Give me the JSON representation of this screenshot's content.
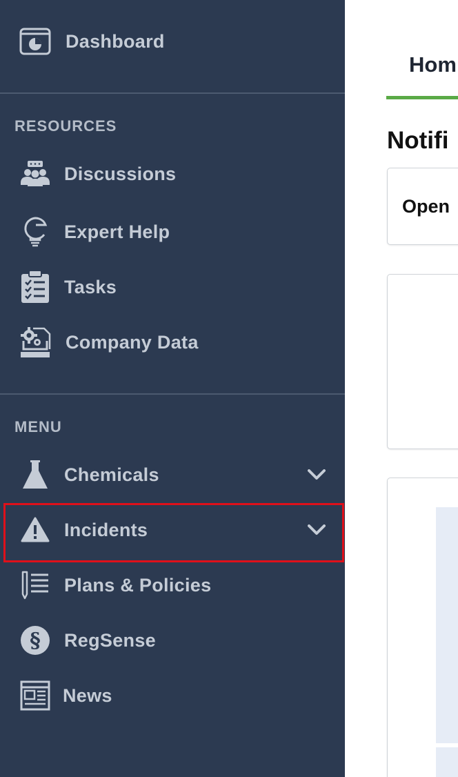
{
  "sidebar": {
    "dashboard": {
      "label": "Dashboard",
      "icon": "dashboard-icon"
    },
    "resources": {
      "header": "RESOURCES",
      "items": [
        {
          "label": "Discussions",
          "icon": "discussions-icon"
        },
        {
          "label": "Expert Help",
          "icon": "expert-help-icon"
        },
        {
          "label": "Tasks",
          "icon": "tasks-icon"
        },
        {
          "label": "Company Data",
          "icon": "company-data-icon"
        }
      ]
    },
    "menu": {
      "header": "MENU",
      "items": [
        {
          "label": "Chemicals",
          "icon": "flask-icon",
          "expandable": true
        },
        {
          "label": "Incidents",
          "icon": "warning-icon",
          "expandable": true,
          "highlighted": true
        },
        {
          "label": "Plans & Policies",
          "icon": "plans-policies-icon"
        },
        {
          "label": "RegSense",
          "icon": "section-sign-icon"
        },
        {
          "label": "News",
          "icon": "newspaper-icon"
        }
      ]
    }
  },
  "main": {
    "tab": {
      "label": "Hom"
    },
    "section_title": "Notifi",
    "card_open_label": "Open"
  },
  "colors": {
    "sidebar_bg": "#2c3a51",
    "sidebar_text": "#c5ccd6",
    "tab_underline": "#5aaa46",
    "highlight": "#e0101a",
    "table_bg": "#e6ecf6"
  }
}
